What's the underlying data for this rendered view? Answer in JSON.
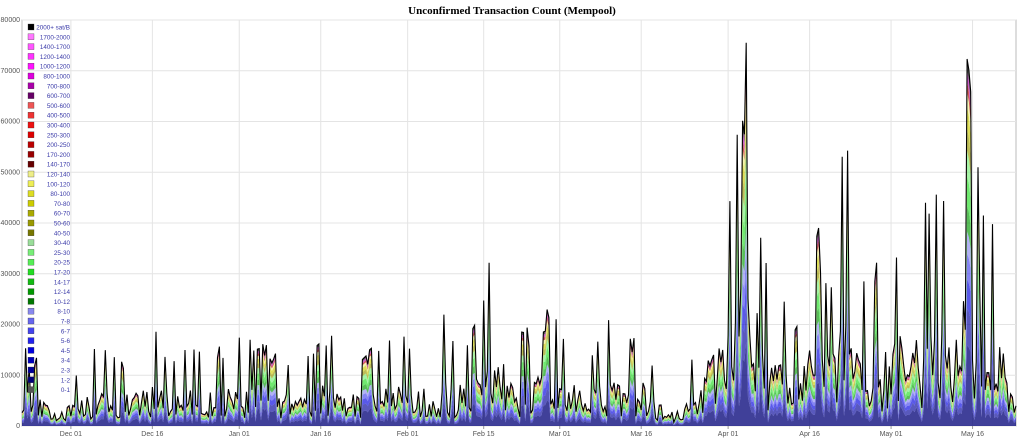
{
  "chart_data": {
    "type": "area",
    "title": "Unconfirmed Transaction Count (Mempool)",
    "xlabel": "",
    "ylabel": "",
    "ylim": [
      0,
      80000
    ],
    "yticks": [
      0,
      10000,
      20000,
      30000,
      40000,
      50000,
      60000,
      70000,
      80000
    ],
    "xlim": [
      "2022-11-22",
      "2023-05-24"
    ],
    "xticks": [
      {
        "date": "2022-12-01",
        "label": "Dec 01"
      },
      {
        "date": "2022-12-16",
        "label": "Dec 16"
      },
      {
        "date": "2023-01-01",
        "label": "Jan 01"
      },
      {
        "date": "2023-01-16",
        "label": "Jan 16"
      },
      {
        "date": "2023-02-01",
        "label": "Feb 01"
      },
      {
        "date": "2023-02-15",
        "label": "Feb 15"
      },
      {
        "date": "2023-03-01",
        "label": "Mar 01"
      },
      {
        "date": "2023-03-16",
        "label": "Mar 16"
      },
      {
        "date": "2023-04-01",
        "label": "Apr 01"
      },
      {
        "date": "2023-04-16",
        "label": "Apr 16"
      },
      {
        "date": "2023-05-01",
        "label": "May 01"
      },
      {
        "date": "2023-05-16",
        "label": "May 16"
      }
    ],
    "grid": true,
    "legend_position": "top-left",
    "series": [
      {
        "name": "2000+ sat/B",
        "color": "#000000"
      },
      {
        "name": "1700-2000",
        "color": "#ff77ff"
      },
      {
        "name": "1400-1700",
        "color": "#ff55ff"
      },
      {
        "name": "1200-1400",
        "color": "#ff33ff"
      },
      {
        "name": "1000-1200",
        "color": "#ff11ff"
      },
      {
        "name": "800-1000",
        "color": "#dd00dd"
      },
      {
        "name": "700-800",
        "color": "#aa00aa"
      },
      {
        "name": "600-700",
        "color": "#660066"
      },
      {
        "name": "500-600",
        "color": "#ee5555"
      },
      {
        "name": "400-500",
        "color": "#ee3333"
      },
      {
        "name": "300-400",
        "color": "#ee1111"
      },
      {
        "name": "250-300",
        "color": "#dd0000"
      },
      {
        "name": "200-250",
        "color": "#bb0000"
      },
      {
        "name": "170-200",
        "color": "#990000"
      },
      {
        "name": "140-170",
        "color": "#660000"
      },
      {
        "name": "120-140",
        "color": "#eeee88"
      },
      {
        "name": "100-120",
        "color": "#eeee55"
      },
      {
        "name": "80-100",
        "color": "#dddd22"
      },
      {
        "name": "70-80",
        "color": "#cccc00"
      },
      {
        "name": "60-70",
        "color": "#aaaa00"
      },
      {
        "name": "50-60",
        "color": "#999900"
      },
      {
        "name": "40-50",
        "color": "#777700"
      },
      {
        "name": "30-40",
        "color": "#99dd99"
      },
      {
        "name": "25-30",
        "color": "#77ee77"
      },
      {
        "name": "20-25",
        "color": "#55ee55"
      },
      {
        "name": "17-20",
        "color": "#22dd22"
      },
      {
        "name": "14-17",
        "color": "#11bb11"
      },
      {
        "name": "12-14",
        "color": "#009900"
      },
      {
        "name": "10-12",
        "color": "#007700"
      },
      {
        "name": "8-10",
        "color": "#8888ee"
      },
      {
        "name": "7-8",
        "color": "#6666ee"
      },
      {
        "name": "6-7",
        "color": "#4444ee"
      },
      {
        "name": "5-6",
        "color": "#2222ee"
      },
      {
        "name": "4-5",
        "color": "#0000dd"
      },
      {
        "name": "3-4",
        "color": "#0000bb"
      },
      {
        "name": "2-3",
        "color": "#000099"
      },
      {
        "name": "1-2",
        "color": "#000077"
      },
      {
        "name": "0-1",
        "color": "#555555"
      }
    ],
    "total_envelope": {
      "x": [
        "2022-11-22",
        "2022-11-26",
        "2022-11-30",
        "2022-12-04",
        "2022-12-08",
        "2022-12-12",
        "2022-12-16",
        "2022-12-20",
        "2022-12-24",
        "2022-12-28",
        "2023-01-01",
        "2023-01-05",
        "2023-01-09",
        "2023-01-13",
        "2023-01-17",
        "2023-01-21",
        "2023-01-25",
        "2023-01-29",
        "2023-02-02",
        "2023-02-06",
        "2023-02-08",
        "2023-02-10",
        "2023-02-13",
        "2023-02-15",
        "2023-02-17",
        "2023-02-20",
        "2023-02-23",
        "2023-02-26",
        "2023-03-01",
        "2023-03-04",
        "2023-03-07",
        "2023-03-10",
        "2023-03-13",
        "2023-03-16",
        "2023-03-19",
        "2023-03-22",
        "2023-03-24",
        "2023-03-26",
        "2023-03-28",
        "2023-03-30",
        "2023-04-01",
        "2023-04-03",
        "2023-04-04",
        "2023-04-05",
        "2023-04-06",
        "2023-04-08",
        "2023-04-10",
        "2023-04-12",
        "2023-04-14",
        "2023-04-16",
        "2023-04-18",
        "2023-04-20",
        "2023-04-22",
        "2023-04-24",
        "2023-04-26",
        "2023-04-28",
        "2023-04-30",
        "2023-05-02",
        "2023-05-04",
        "2023-05-06",
        "2023-05-08",
        "2023-05-10",
        "2023-05-12",
        "2023-05-14",
        "2023-05-15",
        "2023-05-16",
        "2023-05-17",
        "2023-05-18",
        "2023-05-20",
        "2023-05-22",
        "2023-05-24"
      ],
      "values": [
        17000,
        12000,
        9000,
        15000,
        16000,
        14000,
        20000,
        13000,
        18000,
        16000,
        19000,
        17000,
        15000,
        16000,
        20000,
        14000,
        16000,
        20000,
        19000,
        16000,
        26000,
        18000,
        22000,
        32000,
        34000,
        25000,
        20000,
        24000,
        22000,
        23000,
        18000,
        22000,
        17000,
        21000,
        13000,
        6000,
        9000,
        20000,
        27000,
        47000,
        43000,
        62000,
        75000,
        78000,
        57000,
        35000,
        29000,
        27000,
        22000,
        36000,
        40000,
        30000,
        55000,
        62000,
        36000,
        34000,
        35000,
        43000,
        38000,
        42000,
        47000,
        50000,
        35000,
        64000,
        73000,
        67000,
        68000,
        54000,
        42000,
        36000,
        20000
      ]
    }
  }
}
